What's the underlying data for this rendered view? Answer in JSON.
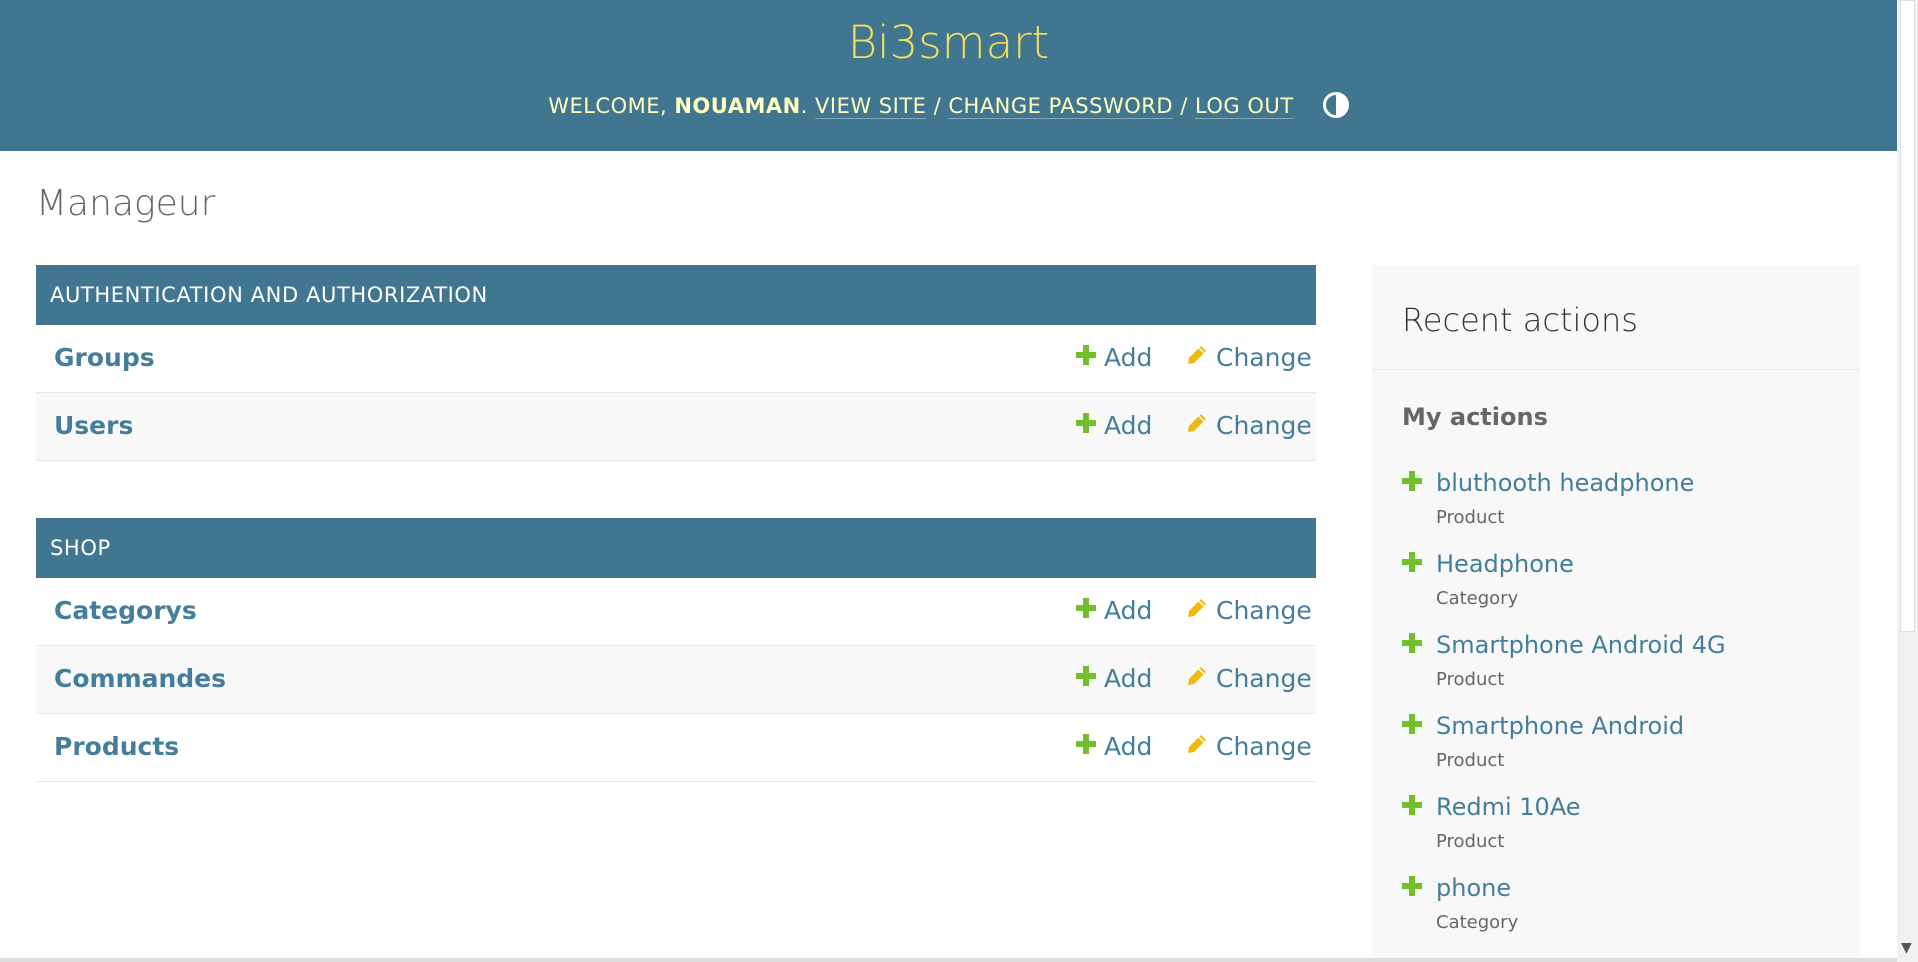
{
  "header": {
    "brand": "Bi3smart",
    "welcome_prefix": "WELCOME, ",
    "username": "NOUAMAN",
    "after_name": ". ",
    "view_site": "VIEW SITE",
    "sep": " / ",
    "change_password": "CHANGE PASSWORD",
    "log_out": "LOG OUT"
  },
  "page_title": "Manageur",
  "add_label": "Add",
  "change_label": "Change",
  "modules": [
    {
      "caption": "AUTHENTICATION AND AUTHORIZATION",
      "models": [
        "Groups",
        "Users"
      ]
    },
    {
      "caption": "SHOP",
      "models": [
        "Categorys",
        "Commandes",
        "Products"
      ]
    }
  ],
  "recent": {
    "title": "Recent actions",
    "subtitle": "My actions",
    "items": [
      {
        "name": "bluthooth headphone",
        "type": "Product"
      },
      {
        "name": "Headphone",
        "type": "Category"
      },
      {
        "name": "Smartphone Android 4G",
        "type": "Product"
      },
      {
        "name": "Smartphone Android",
        "type": "Product"
      },
      {
        "name": "Redmi 10Ae",
        "type": "Product"
      },
      {
        "name": "phone",
        "type": "Category"
      }
    ]
  },
  "colors": {
    "header_bg": "#417690",
    "brand": "#f5dd5d",
    "link": "#447e9b",
    "add_icon": "#70bf2b",
    "change_icon": "#efb80b"
  },
  "icons": [
    "plus-icon",
    "pencil-icon",
    "theme-toggle-icon"
  ]
}
